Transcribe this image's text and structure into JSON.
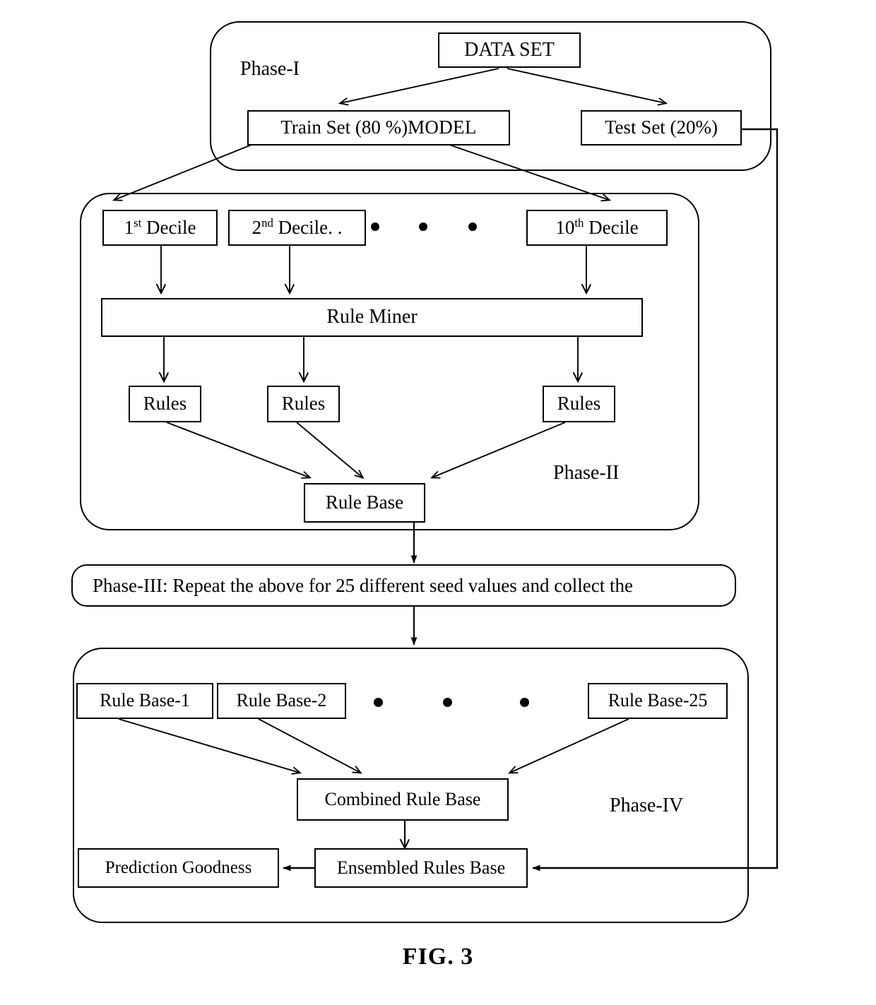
{
  "figure": {
    "caption": "FIG. 3"
  },
  "phases": [
    {
      "id": "phase-1",
      "label": "Phase-I"
    },
    {
      "id": "phase-2",
      "label": "Phase-II"
    },
    {
      "id": "phase-4",
      "label": "Phase-IV"
    }
  ],
  "phase1": {
    "label": "Phase-I",
    "dataset": "DATA SET",
    "train_set_main": "Train Set (80 %) ",
    "train_set_model": "MODEL",
    "test_set": "Test Set (20%)"
  },
  "phase2": {
    "label": "Phase-II",
    "decile_1_num": "1",
    "decile_1_sup": "st",
    "decile_1_rest": " Decile",
    "decile_2_num": "2",
    "decile_2_sup": "nd",
    "decile_2_rest": " Decile. .",
    "decile_10_num": "10",
    "decile_10_sup": "th",
    "decile_10_rest": " Decile",
    "rule_miner": "Rule Miner",
    "rules_1": "Rules",
    "rules_2": "Rules",
    "rules_10": "Rules",
    "rule_base": "Rule Base",
    "ellipsis_dots": 3
  },
  "phase3": {
    "banner_text": "Phase-III: Repeat the above for 25 different seed values and collect the"
  },
  "phase4": {
    "label": "Phase-IV",
    "rule_base_1": "Rule Base-1",
    "rule_base_2": "Rule Base-2",
    "rule_base_25": "Rule Base-25",
    "combined_rule_base": "Combined Rule Base",
    "ensembled_rules_base": "Ensembled Rules Base",
    "prediction_goodness": "Prediction Goodness",
    "ellipsis_dots": 3
  },
  "colors": {
    "stroke": "#000000",
    "background": "#ffffff"
  }
}
